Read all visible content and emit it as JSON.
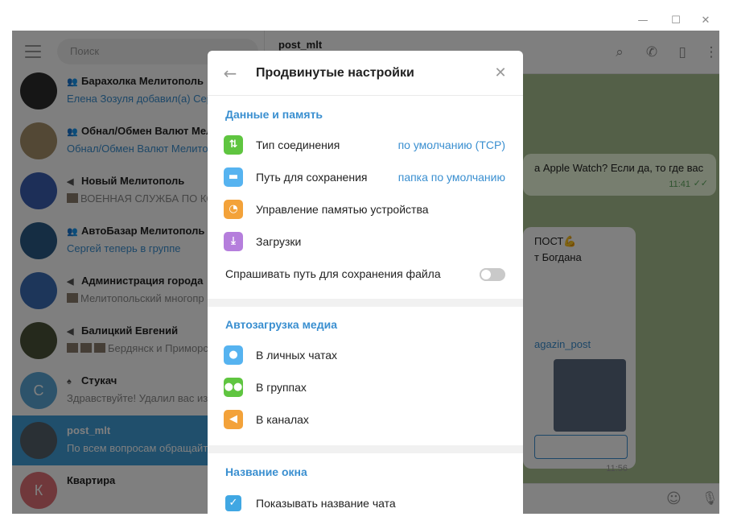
{
  "window": {
    "minimize": "—",
    "maximize": "☐",
    "close": "✕"
  },
  "sidebar": {
    "search_placeholder": "Поиск",
    "chats": [
      {
        "name": "Барахолка Мелитополь",
        "type": "group",
        "preview": "Елена Зозуля добавил(а) Серг",
        "preview_style": "blue",
        "avatar_color": "#2d2d2d"
      },
      {
        "name": "Обнал/Обмен Валют Мели",
        "type": "group",
        "preview": "Обнал/Обмен Валют Мелитопо",
        "preview_style": "blue",
        "avatar_color": "#a7906a"
      },
      {
        "name": "Новый Мелитополь",
        "type": "channel",
        "preview": "ВОЕННАЯ СЛУЖБА ПО КОНТ",
        "preview_style": "thumb",
        "avatar_color": "#3b5fb0"
      },
      {
        "name": "АвтоБазар Мелитополь",
        "type": "group",
        "preview": "Сергей теперь в группе",
        "preview_style": "blue",
        "avatar_color": "#2a5b86"
      },
      {
        "name": "Администрация города",
        "type": "channel",
        "preview": "Мелитопольский многопр",
        "preview_style": "thumb",
        "avatar_color": "#3a6db5"
      },
      {
        "name": "Балицкий Евгений",
        "type": "channel",
        "preview": "Бердянск и Приморск",
        "preview_style": "thumbs3",
        "avatar_color": "#4a5238"
      },
      {
        "name": "Стукач",
        "type": "bot",
        "preview": "Здравствуйте! Удалил вас из",
        "preview_style": "plain",
        "avatar_color": "#5aa7d6",
        "avatar_letter": "С"
      },
      {
        "name": "post_mlt",
        "type": "none",
        "preview": "По всем вопросам обращайт",
        "preview_style": "plain",
        "avatar_color": "#55606b",
        "active": true
      },
      {
        "name": "Квартира",
        "type": "none",
        "preview": "",
        "preview_style": "plain",
        "avatar_color": "#e17076",
        "avatar_letter": "К"
      }
    ]
  },
  "main": {
    "title": "post_mlt",
    "msg1": "а Apple Watch? Если да, то где вас",
    "msg1_time": "11:41",
    "msg2_line1": "ПОСТ💪",
    "msg2_line2": "т Богдана",
    "msg2_link": "agazin_post",
    "msg2_time": "11:56"
  },
  "dialog": {
    "title": "Продвинутые настройки",
    "section_data": "Данные и память",
    "conn_type_label": "Тип соединения",
    "conn_type_value": "по умолчанию (TCP)",
    "save_path_label": "Путь для сохранения",
    "save_path_value": "папка по умолчанию",
    "storage_label": "Управление памятью устройства",
    "downloads_label": "Загрузки",
    "ask_path_label": "Спрашивать путь для сохранения файла",
    "section_autoload": "Автозагрузка медиа",
    "private_label": "В личных чатах",
    "groups_label": "В группах",
    "channels_label": "В каналах",
    "section_window": "Название окна",
    "show_chat_name_label": "Показывать название чата"
  },
  "colors": {
    "accent": "#3a8fd0",
    "active_chat": "#419fd9",
    "icon_green": "#5fc540",
    "icon_blue": "#56b3f0",
    "icon_orange": "#f3a23a",
    "icon_purple": "#b57edc"
  }
}
